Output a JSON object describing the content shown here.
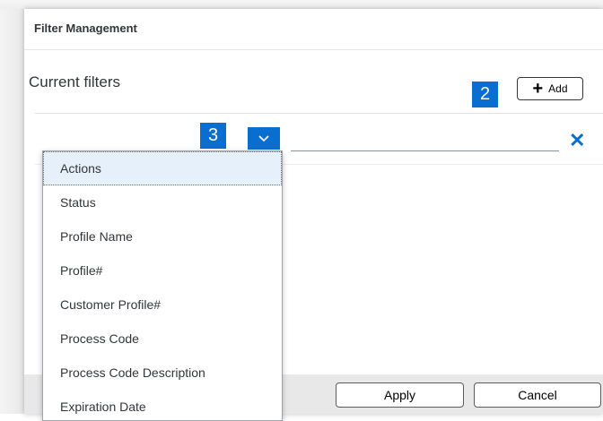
{
  "dialog": {
    "title": "Filter Management"
  },
  "section": {
    "title": "Current filters"
  },
  "callouts": {
    "add": "2",
    "dropdown": "3"
  },
  "add_button": {
    "icon": "plus-icon",
    "label": "Add"
  },
  "filter_row": {
    "dropdown_icon": "chevron-down-icon",
    "remove_icon": "close-icon"
  },
  "dropdown": {
    "selected": "Actions",
    "options": [
      "Actions",
      "Status",
      "Profile Name",
      "Profile#",
      "Customer Profile#",
      "Process Code",
      "Process Code Description",
      "Expiration Date"
    ]
  },
  "footer": {
    "apply_label": "Apply",
    "cancel_label": "Cancel"
  },
  "colors": {
    "accent": "#0a6ed1",
    "selected_bg": "#e5f0fa"
  }
}
